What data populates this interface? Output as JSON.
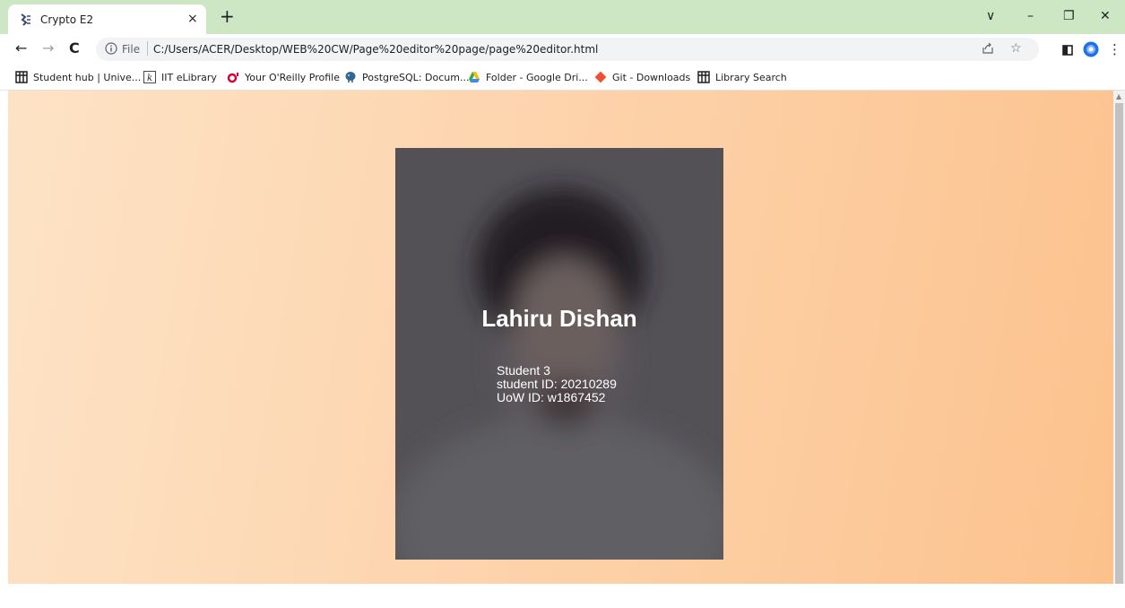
{
  "browser": {
    "tab": {
      "title": "Crypto E2",
      "close_glyph": "×",
      "favicon": "crypto-favicon-icon"
    },
    "new_tab_glyph": "+",
    "window_controls": {
      "tab_search": "∨",
      "minimize": "–",
      "restore": "❐",
      "close": "✕"
    },
    "nav": {
      "back": "←",
      "forward": "→",
      "reload": "C"
    },
    "omnibox": {
      "scheme_label": "File",
      "url": "C:/Users/ACER/Desktop/WEB%20CW/Page%20editor%20page/page%20editor.html",
      "share_icon": "share-icon",
      "star_icon": "☆"
    },
    "toolbar_icons": {
      "sidebar": "side-panel-icon",
      "profile": "profile-icon",
      "menu": "⋮"
    },
    "bookmarks": [
      {
        "label": "Student hub | Unive...",
        "icon": "grid-icon"
      },
      {
        "label": "IIT eLibrary",
        "icon": "k-icon"
      },
      {
        "label": "Your O'Reilly Profile",
        "icon": "oreilly-icon"
      },
      {
        "label": "PostgreSQL: Docum...",
        "icon": "elephant-icon"
      },
      {
        "label": "Folder - Google Dri...",
        "icon": "drive-icon"
      },
      {
        "label": "Git - Downloads",
        "icon": "git-icon"
      },
      {
        "label": "Library Search",
        "icon": "grid-icon"
      }
    ]
  },
  "page": {
    "background_colors": [
      "#fde3c6",
      "#fcc28d"
    ],
    "card": {
      "name": "Lahiru Dishan",
      "role": "Student 3",
      "student_id": "student ID: 20210289",
      "uow_id": "UoW ID: w1867452"
    }
  }
}
